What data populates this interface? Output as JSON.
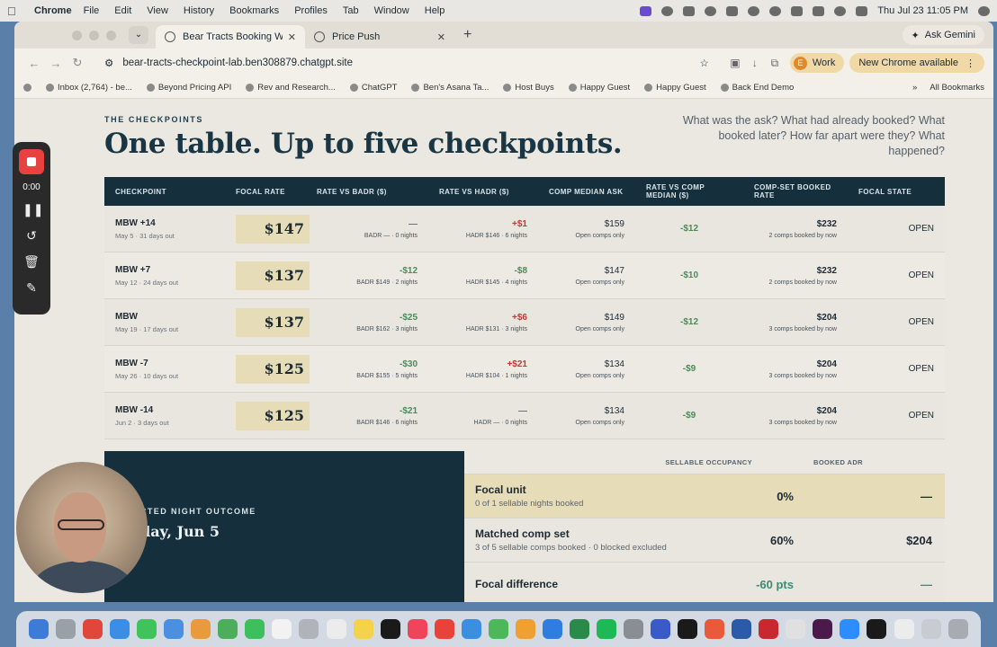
{
  "menubar": {
    "app_name": "Chrome",
    "items": [
      "File",
      "Edit",
      "View",
      "History",
      "Bookmarks",
      "Profiles",
      "Tab",
      "Window",
      "Help"
    ],
    "datetime": "Thu Jul 23  11:05 PM"
  },
  "browser": {
    "tabs": [
      {
        "title": "Bear Tracts Booking Window"
      },
      {
        "title": "Price Push"
      }
    ],
    "gemini_label": "Ask Gemini",
    "url": "bear-tracts-checkpoint-lab.ben308879.chatgpt.site",
    "profile_label": "Work",
    "profile_initial": "E",
    "update_label": "New Chrome available",
    "bookmarks": [
      "Inbox (2,764) - be...",
      "Beyond Pricing API",
      "Rev and Research...",
      "ChatGPT",
      "Ben's Asana Ta...",
      "Host Buys",
      "Happy Guest",
      "Happy Guest",
      "Back End Demo"
    ],
    "all_bookmarks": "All Bookmarks"
  },
  "recorder": {
    "timer": "0:00"
  },
  "section": {
    "eyebrow": "THE CHECKPOINTS",
    "headline": "One table. Up to five checkpoints.",
    "questions": "What was the ask? What had already booked? What booked later? How far apart were they? What happened?"
  },
  "table": {
    "headers": [
      "CHECKPOINT",
      "FOCAL RATE",
      "RATE VS BADR ($)",
      "RATE VS HADR ($)",
      "COMP MEDIAN ASK",
      "RATE VS COMP MEDIAN ($)",
      "COMP-SET BOOKED RATE",
      "FOCAL STATE"
    ],
    "rows": [
      {
        "name": "MBW +14",
        "sub": "May 5 · 31 days out",
        "rate": "$147",
        "badr": "—",
        "badr_sub": "BADR — · 0 nights",
        "hadr": "+$1",
        "hadr_sub": "HADR $146 · 6 nights",
        "comp": "$159",
        "comp_sub": "Open comps only",
        "vs_comp": "-$12",
        "booked": "$232",
        "booked_sub": "2 comps booked by now",
        "state": "OPEN"
      },
      {
        "name": "MBW +7",
        "sub": "May 12 · 24 days out",
        "rate": "$137",
        "badr": "-$12",
        "badr_sub": "BADR $149 · 2 nights",
        "hadr": "-$8",
        "hadr_sub": "HADR $145 · 4 nights",
        "comp": "$147",
        "comp_sub": "Open comps only",
        "vs_comp": "-$10",
        "booked": "$232",
        "booked_sub": "2 comps booked by now",
        "state": "OPEN"
      },
      {
        "name": "MBW",
        "sub": "May 19 · 17 days out",
        "rate": "$137",
        "badr": "-$25",
        "badr_sub": "BADR $162 · 3 nights",
        "hadr": "+$6",
        "hadr_sub": "HADR $131 · 3 nights",
        "comp": "$149",
        "comp_sub": "Open comps only",
        "vs_comp": "-$12",
        "booked": "$204",
        "booked_sub": "3 comps booked by now",
        "state": "OPEN"
      },
      {
        "name": "MBW -7",
        "sub": "May 26 · 10 days out",
        "rate": "$125",
        "badr": "-$30",
        "badr_sub": "BADR $155 · 5 nights",
        "hadr": "+$21",
        "hadr_sub": "HADR $104 · 1 nights",
        "comp": "$134",
        "comp_sub": "Open comps only",
        "vs_comp": "-$9",
        "booked": "$204",
        "booked_sub": "3 comps booked by now",
        "state": "OPEN"
      },
      {
        "name": "MBW -14",
        "sub": "Jun 2 · 3 days out",
        "rate": "$125",
        "badr": "-$21",
        "badr_sub": "BADR $146 · 6 nights",
        "hadr": "—",
        "hadr_sub": "HADR — · 0 nights",
        "comp": "$134",
        "comp_sub": "Open comps only",
        "vs_comp": "-$9",
        "booked": "$204",
        "booked_sub": "3 comps booked by now",
        "state": "OPEN"
      }
    ]
  },
  "outcome": {
    "label": "CTED NIGHT OUTCOME",
    "date": "day, Jun 5",
    "headers": [
      "SELLABLE OCCUPANCY",
      "BOOKED ADR"
    ],
    "rows": [
      {
        "name": "Focal unit",
        "sub": "0 of 1 sellable nights booked",
        "occ": "0%",
        "adr": "—"
      },
      {
        "name": "Matched comp set",
        "sub": "3 of 5 sellable comps booked · 0 blocked excluded",
        "occ": "60%",
        "adr": "$204"
      },
      {
        "name": "Focal difference",
        "sub": "",
        "occ": "-60 pts",
        "adr": "—"
      }
    ]
  }
}
